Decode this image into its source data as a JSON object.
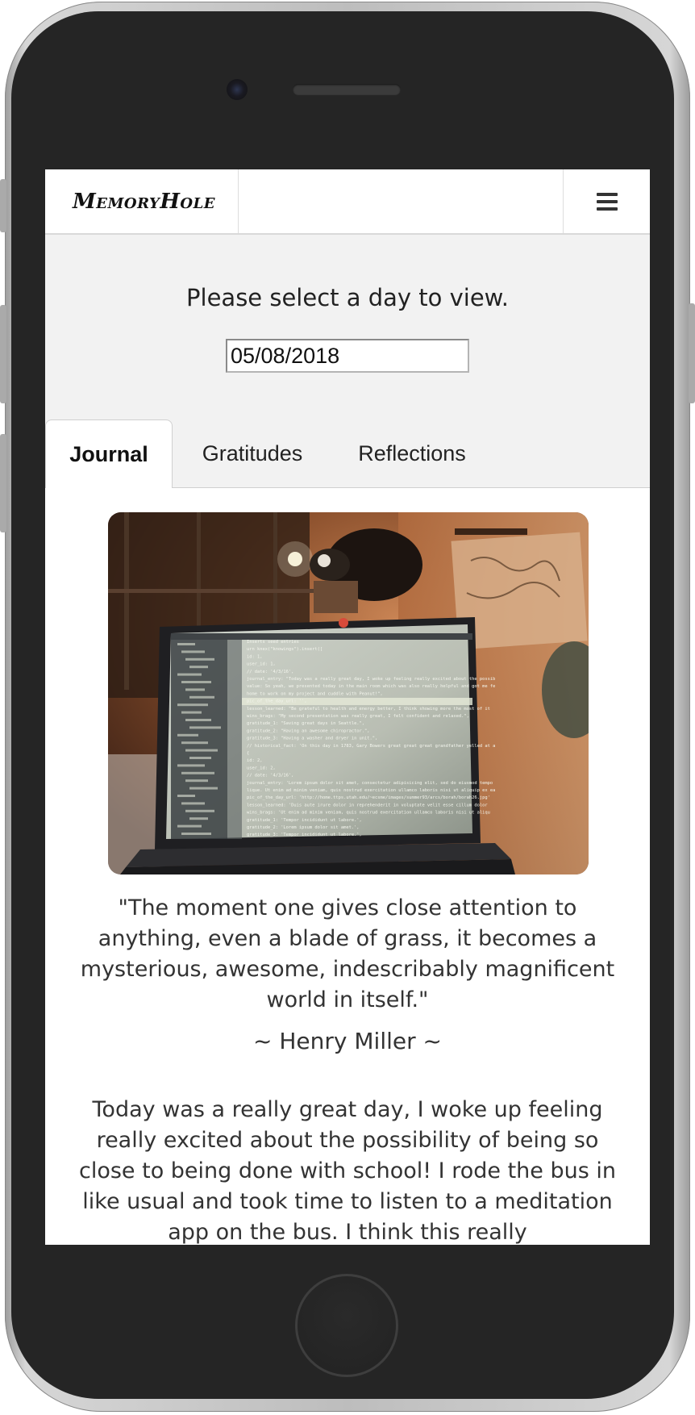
{
  "app": {
    "brand": "MemoryHole"
  },
  "date_picker": {
    "prompt": "Please select a day to view.",
    "value": "05/08/2018"
  },
  "tabs": [
    {
      "label": "Journal",
      "active": true
    },
    {
      "label": "Gratitudes",
      "active": false
    },
    {
      "label": "Reflections",
      "active": false
    }
  ],
  "journal": {
    "quote": "\"The moment one gives close attention to anything, even a blade of grass, it becomes a mysterious, awesome, indescribably magnificent world in itself.\"",
    "author": "~ Henry Miller ~",
    "entry": "Today was a really great day, I woke up feeling really excited about the possibility of being so close to being done with school! I rode the bus in like usual and took time to listen to a meditation app on the bus. I think this really"
  },
  "code_lines": [
    "Inserts seed entries",
    "urn knex(\"knowings\").insert([",
    "id: 1,",
    "user_id: 1,",
    "// date: '4/3/16',",
    "journal_entry: \"Today was a really great day, I woke up feeling really excited about the possibility",
    "value: So yeah, we presented today in the main room which was also really helpful and got me feel",
    "home to work on my project and cuddle with Peanut!\",",
    "pic_of_the_day_url: '',",
    "lesson_learned: \"Be grateful to health and energy better, I think showing more the most of it",
    "wins_brags: \"My second presentation was really great, I felt confident and relaxed.\",",
    "gratitude_1: \"Saving great days in Seattle.\",",
    "gratitude_2: \"Having an awesome chiropractor.\",",
    "gratitude_3: \"Having a washer and dryer in unit.\",",
    "// historical_fact: 'On this day in 1783, Gary Bowers great great great grandfather yelled at a",
    "{",
    "id: 2,",
    "user_id: 2,",
    "// date: '4/3/16',",
    "journal_entry: 'Lorem ipsum dolor sit amet, consectetur adipisicing elit, sed do eiusmod tempo",
    "lique. Ut enim ad minim veniam, quis nostrud exercitation ullamco laboris nisi ut aliquip ex ea c",
    "pic_of_the_day_url: 'http://home.ttps.utah.edu/~ecsme/images/summer93/arcs/borah/borah26.jpg'",
    "lesson_learned: 'Duis aute irure dolor in reprehenderit in voluptate velit esse cillum dolor",
    "wins_brags: 'Ut enim ad minim veniam, quis nostrud exercitation ullamco laboris nisi ut aliqu",
    "gratitude_1: 'Tempor incididunt ut labore.',",
    "gratitude_2: 'Lorem ipsum dolor sit amet.',",
    "gratitude_3: 'Tempor incididunt ut labore.',"
  ]
}
